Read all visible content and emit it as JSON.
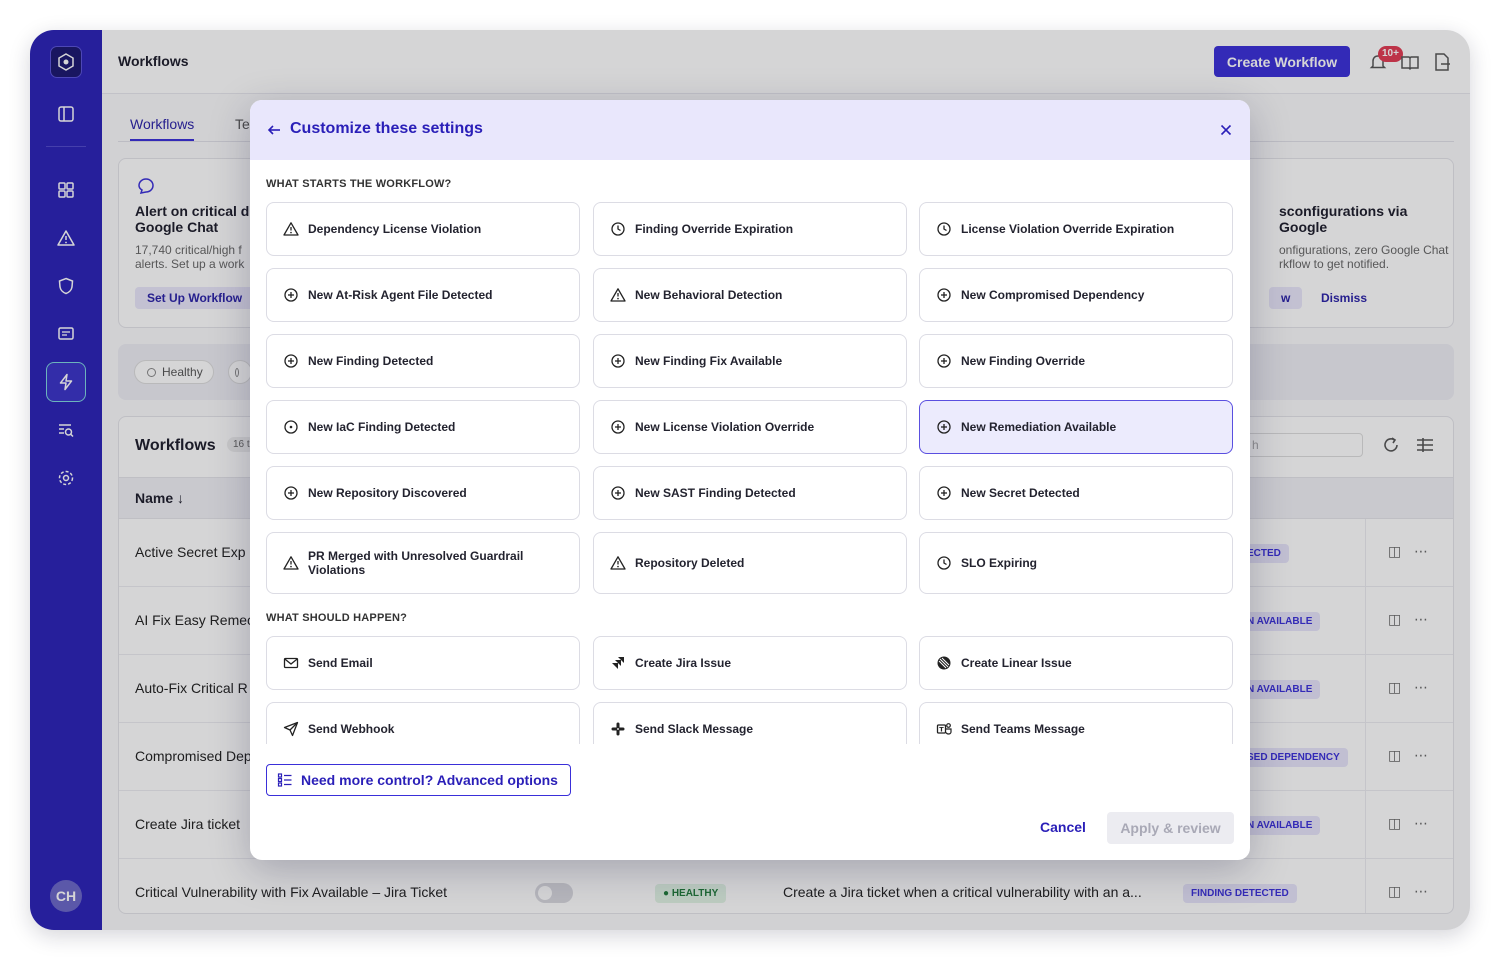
{
  "app": {
    "page_title": "Workflows",
    "create_button": "Create Workflow",
    "notif_badge": "10+",
    "avatar_initials": "CH"
  },
  "tabs": [
    {
      "label": "Workflows"
    },
    {
      "label": "Te"
    }
  ],
  "cards": [
    {
      "title": "Alert on critical d",
      "title2": "Google Chat",
      "desc": "17,740 critical/high f",
      "desc2": "alerts. Set up a work",
      "button": "Set Up Workflow"
    },
    {
      "title": "sconfigurations via Google",
      "desc": "onfigurations, zero Google Chat",
      "desc2": "rkflow to get notified.",
      "button": "w",
      "dismiss": "Dismiss"
    }
  ],
  "filters": [
    {
      "label": "Healthy"
    },
    {
      "label": ""
    }
  ],
  "table": {
    "title": "Workflows",
    "count": "16 t",
    "col_name": "Name ↓",
    "search_placeholder": "h",
    "rows": [
      {
        "name": "Active Secret Exp",
        "badge": "ECTED"
      },
      {
        "name": "AI Fix Easy Remec",
        "badge": "N AVAILABLE"
      },
      {
        "name": "Auto-Fix Critical R",
        "badge": "N AVAILABLE"
      },
      {
        "name": "Compromised Dep",
        "badge": "SED DEPENDENCY"
      },
      {
        "name": "Create Jira ticket",
        "badge": "N AVAILABLE"
      },
      {
        "name": "Critical Vulnerability with Fix Available – Jira Ticket",
        "healthy": "● HEALTHY",
        "desc": "Create a Jira ticket when a critical vulnerability with an a...",
        "badge": "FINDING DETECTED"
      }
    ]
  },
  "modal": {
    "title": "Customize these settings",
    "triggers_label": "WHAT STARTS THE WORKFLOW?",
    "actions_label": "WHAT SHOULD HAPPEN?",
    "triggers": [
      {
        "label": "Dependency License Violation",
        "icon": "warning-icon"
      },
      {
        "label": "Finding Override Expiration",
        "icon": "clock-icon"
      },
      {
        "label": "License Violation Override Expiration",
        "icon": "clock-icon"
      },
      {
        "label": "New At-Risk Agent File Detected",
        "icon": "plus-circle-icon"
      },
      {
        "label": "New Behavioral Detection",
        "icon": "warning-icon"
      },
      {
        "label": "New Compromised Dependency",
        "icon": "plus-circle-icon"
      },
      {
        "label": "New Finding Detected",
        "icon": "plus-circle-icon"
      },
      {
        "label": "New Finding Fix Available",
        "icon": "plus-circle-icon"
      },
      {
        "label": "New Finding Override",
        "icon": "plus-circle-icon"
      },
      {
        "label": "New IaC Finding Detected",
        "icon": "dot-circle-icon"
      },
      {
        "label": "New License Violation Override",
        "icon": "plus-circle-icon"
      },
      {
        "label": "New Remediation Available",
        "icon": "plus-circle-icon"
      },
      {
        "label": "New Repository Discovered",
        "icon": "plus-circle-icon"
      },
      {
        "label": "New SAST Finding Detected",
        "icon": "plus-circle-icon"
      },
      {
        "label": "New Secret Detected",
        "icon": "plus-circle-icon"
      },
      {
        "label": "PR Merged with Unresolved Guardrail Violations",
        "icon": "warning-icon"
      },
      {
        "label": "Repository Deleted",
        "icon": "warning-icon"
      },
      {
        "label": "SLO Expiring",
        "icon": "clock-icon"
      }
    ],
    "selected_trigger": "New Remediation Available",
    "actions": [
      {
        "label": "Send Email",
        "icon": "mail-icon"
      },
      {
        "label": "Create Jira Issue",
        "icon": "jira-icon"
      },
      {
        "label": "Create Linear Issue",
        "icon": "linear-icon"
      },
      {
        "label": "Send Webhook",
        "icon": "send-icon"
      },
      {
        "label": "Send Slack Message",
        "icon": "slack-icon"
      },
      {
        "label": "Send Teams Message",
        "icon": "teams-icon"
      }
    ],
    "advanced_button": "Need more control? Advanced options",
    "cancel": "Cancel",
    "apply": "Apply & review"
  },
  "colors": {
    "brand": "#2a22b8",
    "accent": "#3a2fd9",
    "selected_bg": "#ecebfd"
  }
}
